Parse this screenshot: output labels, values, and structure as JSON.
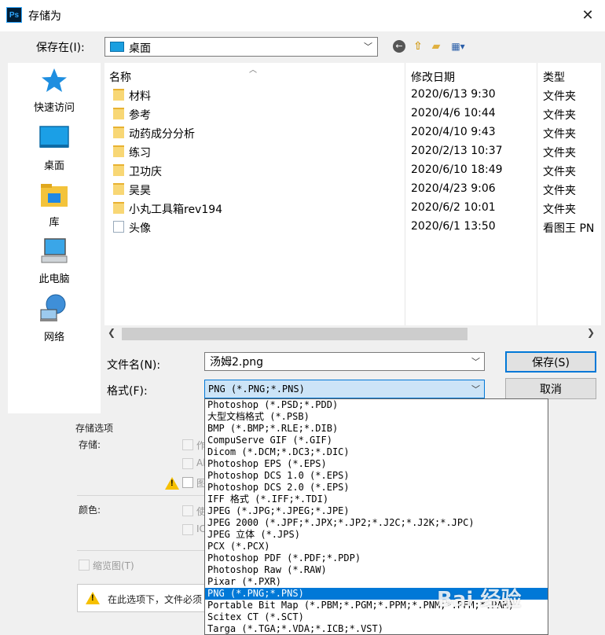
{
  "window": {
    "title": "存储为",
    "app_icon": "Ps"
  },
  "savein": {
    "label": "保存在(I):",
    "value": "桌面"
  },
  "places": [
    {
      "label": "快速访问",
      "icon": "star-icon"
    },
    {
      "label": "桌面",
      "icon": "desktop-icon"
    },
    {
      "label": "库",
      "icon": "library-icon"
    },
    {
      "label": "此电脑",
      "icon": "computer-icon"
    },
    {
      "label": "网络",
      "icon": "network-icon"
    }
  ],
  "columns": {
    "name": "名称",
    "date": "修改日期",
    "type": "类型"
  },
  "files": [
    {
      "name": "材料",
      "date": "2020/6/13 9:30",
      "type": "文件夹"
    },
    {
      "name": "参考",
      "date": "2020/4/6 10:44",
      "type": "文件夹"
    },
    {
      "name": "动药成分分析",
      "date": "2020/4/10 9:43",
      "type": "文件夹"
    },
    {
      "name": "练习",
      "date": "2020/2/13 10:37",
      "type": "文件夹"
    },
    {
      "name": "卫功庆",
      "date": "2020/6/10 18:49",
      "type": "文件夹"
    },
    {
      "name": "吴昊",
      "date": "2020/4/23 9:06",
      "type": "文件夹"
    },
    {
      "name": "小丸工具箱rev194",
      "date": "2020/6/2 10:01",
      "type": "文件夹"
    },
    {
      "name": "头像",
      "date": "2020/6/1 13:50",
      "type": "看图王 PN"
    }
  ],
  "filename": {
    "label": "文件名(N):",
    "value": "汤姆2.png"
  },
  "format": {
    "label": "格式(F):",
    "value": "PNG (*.PNG;*.PNS)",
    "options": [
      "Photoshop (*.PSD;*.PDD)",
      "大型文档格式 (*.PSB)",
      "BMP (*.BMP;*.RLE;*.DIB)",
      "CompuServe GIF (*.GIF)",
      "Dicom (*.DCM;*.DC3;*.DIC)",
      "Photoshop EPS (*.EPS)",
      "Photoshop DCS 1.0 (*.EPS)",
      "Photoshop DCS 2.0 (*.EPS)",
      "IFF 格式 (*.IFF;*.TDI)",
      "JPEG (*.JPG;*.JPEG;*.JPE)",
      "JPEG 2000 (*.JPF;*.JPX;*.JP2;*.J2C;*.J2K;*.JPC)",
      "JPEG 立体 (*.JPS)",
      "PCX (*.PCX)",
      "Photoshop PDF (*.PDF;*.PDP)",
      "Photoshop Raw (*.RAW)",
      "Pixar (*.PXR)",
      "PNG (*.PNG;*.PNS)",
      "Portable Bit Map (*.PBM;*.PGM;*.PPM;*.PNM;*.PFM;*.PAM)",
      "Scitex CT (*.SCT)",
      "Targa (*.TGA;*.VDA;*.ICB;*.VST)"
    ],
    "selected_index": 16
  },
  "buttons": {
    "save": "保存(S)",
    "cancel": "取消"
  },
  "options": {
    "group_title": "存储选项",
    "save_label": "存储:",
    "save_opt1": "作",
    "save_opt2": "Al",
    "save_opt3": "图",
    "color_label": "颜色:",
    "color_opt1": "使",
    "color_opt2": "IC",
    "thumbnail": "缩览图(T)",
    "notice": "在此选项下，文件必须"
  },
  "watermark": "Bai 经验"
}
